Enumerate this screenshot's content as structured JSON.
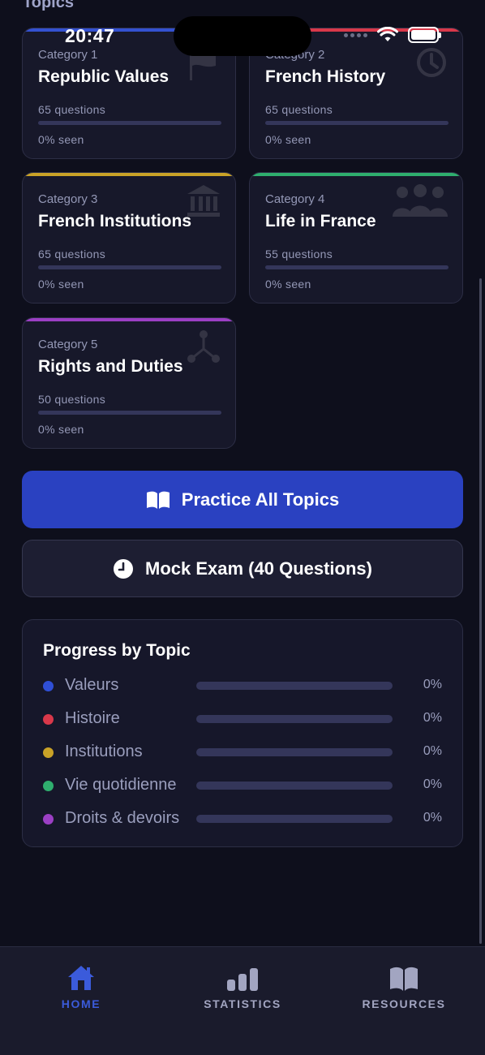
{
  "header": {
    "section_title": "Topics"
  },
  "status_bar": {
    "time": "20:47"
  },
  "categories": [
    {
      "category_label": "Category 1",
      "title": "Republic Values",
      "questions": "65 questions",
      "seen": "0% seen",
      "progress": 0,
      "accent": "#3451d1",
      "icon": "flag-icon"
    },
    {
      "category_label": "Category 2",
      "title": "French History",
      "questions": "65 questions",
      "seen": "0% seen",
      "progress": 0,
      "accent": "#d9384a",
      "icon": "history-clock-icon"
    },
    {
      "category_label": "Category 3",
      "title": "French Institutions",
      "questions": "65 questions",
      "seen": "0% seen",
      "progress": 0,
      "accent": "#c9a227",
      "icon": "institution-building-icon"
    },
    {
      "category_label": "Category 4",
      "title": "Life in France",
      "questions": "55 questions",
      "seen": "0% seen",
      "progress": 0,
      "accent": "#2fae6e",
      "icon": "people-group-icon"
    },
    {
      "category_label": "Category 5",
      "title": "Rights and Duties",
      "questions": "50 questions",
      "seen": "0% seen",
      "progress": 0,
      "accent": "#9b3fc4",
      "icon": "network-nodes-icon"
    }
  ],
  "actions": {
    "practice_all": "Practice All Topics",
    "mock_exam": "Mock Exam (40 Questions)"
  },
  "progress_by_topic": {
    "title": "Progress by Topic",
    "rows": [
      {
        "label": "Valeurs",
        "percent": "0%",
        "value": 0,
        "color": "#2f4fd6"
      },
      {
        "label": "Histoire",
        "percent": "0%",
        "value": 0,
        "color": "#d9384a"
      },
      {
        "label": "Institutions",
        "percent": "0%",
        "value": 0,
        "color": "#c9a227"
      },
      {
        "label": "Vie quotidienne",
        "percent": "0%",
        "value": 0,
        "color": "#2fae6e"
      },
      {
        "label": "Droits & devoirs",
        "percent": "0%",
        "value": 0,
        "color": "#9b3fc4"
      }
    ]
  },
  "tabbar": {
    "tabs": [
      {
        "label": "HOME",
        "icon": "home-icon",
        "active": true
      },
      {
        "label": "STATISTICS",
        "icon": "bar-chart-icon",
        "active": false
      },
      {
        "label": "RESOURCES",
        "icon": "book-icon",
        "active": false
      }
    ]
  }
}
